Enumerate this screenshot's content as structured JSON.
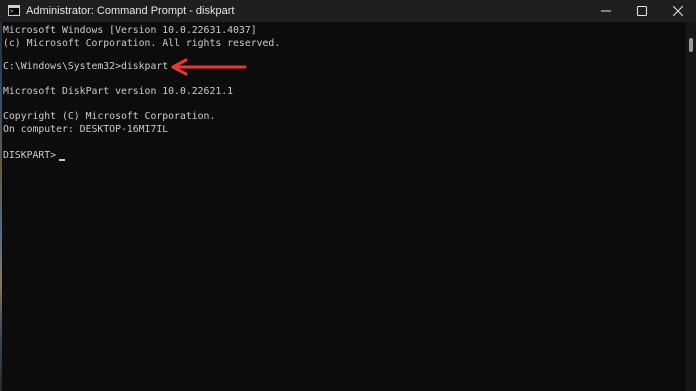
{
  "window": {
    "title": "Administrator: Command Prompt - diskpart",
    "controls": {
      "minimize": "minimize-icon",
      "maximize": "maximize-icon",
      "close": "close-icon"
    }
  },
  "terminal": {
    "lines": [
      "Microsoft Windows [Version 10.0.22631.4037]",
      "(c) Microsoft Corporation. All rights reserved.",
      "",
      "C:\\Windows\\System32>diskpart",
      "",
      "Microsoft DiskPart version 10.0.22621.1",
      "",
      "Copyright (C) Microsoft Corporation.",
      "On computer: DESKTOP-16MI7IL",
      "",
      "DISKPART> "
    ]
  },
  "colors": {
    "terminal_bg": "#0c0c0c",
    "terminal_text": "#cccccc",
    "titlebar_bg": "#1f1f1f",
    "annotation_arrow": "#e53935"
  }
}
